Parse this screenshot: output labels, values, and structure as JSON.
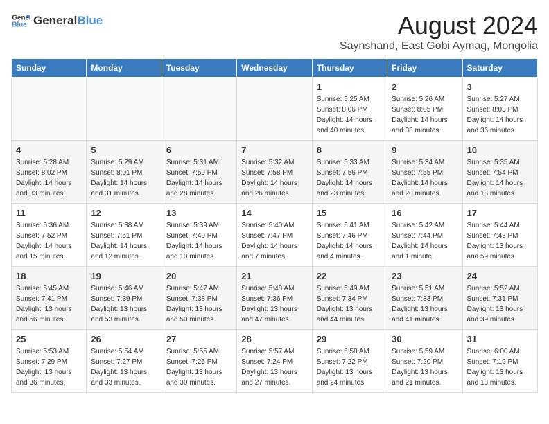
{
  "header": {
    "logo_general": "General",
    "logo_blue": "Blue",
    "main_title": "August 2024",
    "subtitle": "Saynshand, East Gobi Aymag, Mongolia"
  },
  "weekdays": [
    "Sunday",
    "Monday",
    "Tuesday",
    "Wednesday",
    "Thursday",
    "Friday",
    "Saturday"
  ],
  "weeks": [
    [
      {
        "day": "",
        "info": ""
      },
      {
        "day": "",
        "info": ""
      },
      {
        "day": "",
        "info": ""
      },
      {
        "day": "",
        "info": ""
      },
      {
        "day": "1",
        "info": "Sunrise: 5:25 AM\nSunset: 8:06 PM\nDaylight: 14 hours\nand 40 minutes."
      },
      {
        "day": "2",
        "info": "Sunrise: 5:26 AM\nSunset: 8:05 PM\nDaylight: 14 hours\nand 38 minutes."
      },
      {
        "day": "3",
        "info": "Sunrise: 5:27 AM\nSunset: 8:03 PM\nDaylight: 14 hours\nand 36 minutes."
      }
    ],
    [
      {
        "day": "4",
        "info": "Sunrise: 5:28 AM\nSunset: 8:02 PM\nDaylight: 14 hours\nand 33 minutes."
      },
      {
        "day": "5",
        "info": "Sunrise: 5:29 AM\nSunset: 8:01 PM\nDaylight: 14 hours\nand 31 minutes."
      },
      {
        "day": "6",
        "info": "Sunrise: 5:31 AM\nSunset: 7:59 PM\nDaylight: 14 hours\nand 28 minutes."
      },
      {
        "day": "7",
        "info": "Sunrise: 5:32 AM\nSunset: 7:58 PM\nDaylight: 14 hours\nand 26 minutes."
      },
      {
        "day": "8",
        "info": "Sunrise: 5:33 AM\nSunset: 7:56 PM\nDaylight: 14 hours\nand 23 minutes."
      },
      {
        "day": "9",
        "info": "Sunrise: 5:34 AM\nSunset: 7:55 PM\nDaylight: 14 hours\nand 20 minutes."
      },
      {
        "day": "10",
        "info": "Sunrise: 5:35 AM\nSunset: 7:54 PM\nDaylight: 14 hours\nand 18 minutes."
      }
    ],
    [
      {
        "day": "11",
        "info": "Sunrise: 5:36 AM\nSunset: 7:52 PM\nDaylight: 14 hours\nand 15 minutes."
      },
      {
        "day": "12",
        "info": "Sunrise: 5:38 AM\nSunset: 7:51 PM\nDaylight: 14 hours\nand 12 minutes."
      },
      {
        "day": "13",
        "info": "Sunrise: 5:39 AM\nSunset: 7:49 PM\nDaylight: 14 hours\nand 10 minutes."
      },
      {
        "day": "14",
        "info": "Sunrise: 5:40 AM\nSunset: 7:47 PM\nDaylight: 14 hours\nand 7 minutes."
      },
      {
        "day": "15",
        "info": "Sunrise: 5:41 AM\nSunset: 7:46 PM\nDaylight: 14 hours\nand 4 minutes."
      },
      {
        "day": "16",
        "info": "Sunrise: 5:42 AM\nSunset: 7:44 PM\nDaylight: 14 hours\nand 1 minute."
      },
      {
        "day": "17",
        "info": "Sunrise: 5:44 AM\nSunset: 7:43 PM\nDaylight: 13 hours\nand 59 minutes."
      }
    ],
    [
      {
        "day": "18",
        "info": "Sunrise: 5:45 AM\nSunset: 7:41 PM\nDaylight: 13 hours\nand 56 minutes."
      },
      {
        "day": "19",
        "info": "Sunrise: 5:46 AM\nSunset: 7:39 PM\nDaylight: 13 hours\nand 53 minutes."
      },
      {
        "day": "20",
        "info": "Sunrise: 5:47 AM\nSunset: 7:38 PM\nDaylight: 13 hours\nand 50 minutes."
      },
      {
        "day": "21",
        "info": "Sunrise: 5:48 AM\nSunset: 7:36 PM\nDaylight: 13 hours\nand 47 minutes."
      },
      {
        "day": "22",
        "info": "Sunrise: 5:49 AM\nSunset: 7:34 PM\nDaylight: 13 hours\nand 44 minutes."
      },
      {
        "day": "23",
        "info": "Sunrise: 5:51 AM\nSunset: 7:33 PM\nDaylight: 13 hours\nand 41 minutes."
      },
      {
        "day": "24",
        "info": "Sunrise: 5:52 AM\nSunset: 7:31 PM\nDaylight: 13 hours\nand 39 minutes."
      }
    ],
    [
      {
        "day": "25",
        "info": "Sunrise: 5:53 AM\nSunset: 7:29 PM\nDaylight: 13 hours\nand 36 minutes."
      },
      {
        "day": "26",
        "info": "Sunrise: 5:54 AM\nSunset: 7:27 PM\nDaylight: 13 hours\nand 33 minutes."
      },
      {
        "day": "27",
        "info": "Sunrise: 5:55 AM\nSunset: 7:26 PM\nDaylight: 13 hours\nand 30 minutes."
      },
      {
        "day": "28",
        "info": "Sunrise: 5:57 AM\nSunset: 7:24 PM\nDaylight: 13 hours\nand 27 minutes."
      },
      {
        "day": "29",
        "info": "Sunrise: 5:58 AM\nSunset: 7:22 PM\nDaylight: 13 hours\nand 24 minutes."
      },
      {
        "day": "30",
        "info": "Sunrise: 5:59 AM\nSunset: 7:20 PM\nDaylight: 13 hours\nand 21 minutes."
      },
      {
        "day": "31",
        "info": "Sunrise: 6:00 AM\nSunset: 7:19 PM\nDaylight: 13 hours\nand 18 minutes."
      }
    ]
  ]
}
